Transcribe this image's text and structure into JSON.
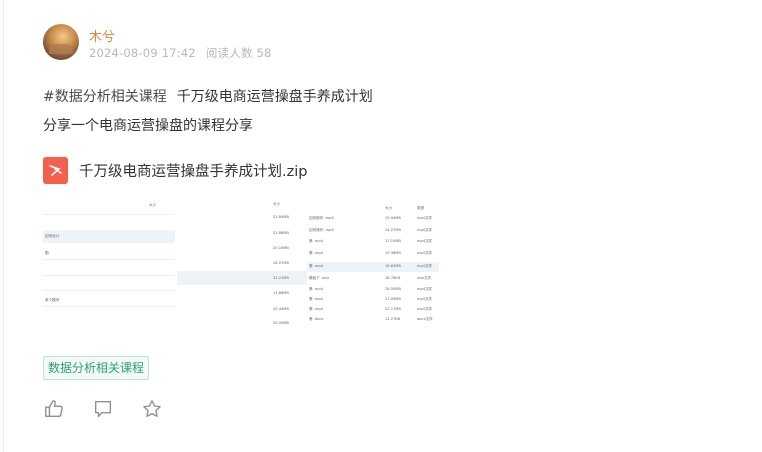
{
  "author": {
    "name": "木兮",
    "date": "2024-08-09 17:42",
    "reads": "阅读人数 58"
  },
  "post": {
    "topic": "#数据分析相关课程",
    "title": "千万级电商运营操盘手养成计划",
    "body": "分享一个电商运营操盘的课程分享"
  },
  "attachment": {
    "file_name": "千万级电商运营操盘手养成计划.zip",
    "icon": "pdf-style-file-icon"
  },
  "tag": {
    "label": "数据分析相关课程"
  },
  "actions": [
    {
      "name": "like-icon"
    },
    {
      "name": "comment-icon"
    },
    {
      "name": "favorite-star-icon"
    }
  ],
  "thumbs": {
    "t1": {
      "header": "大小",
      "rows": [
        "如何设计",
        "图",
        "某个模块"
      ]
    },
    "t2": {
      "header": "大小",
      "sizes": [
        "23.84MB",
        "23.88MB",
        "20.16MB",
        "26.07MB",
        "31.21MB",
        "11.68MB",
        "20.44MB",
        "20.50MB"
      ]
    },
    "t3": {
      "header1": "大小",
      "header2": "类型",
      "rows": [
        {
          "n": "如何制作 .mp4",
          "s": "19.94MB",
          "t": "mp4文件"
        },
        {
          "n": "如何操作 .mp4",
          "s": "24.07MB",
          "t": "mp4文件"
        },
        {
          "n": "第 .mp4",
          "s": "17.10MB",
          "t": "mp4文件"
        },
        {
          "n": "第 .mp4",
          "s": "19.38MB",
          "t": "mp4文件"
        },
        {
          "n": "第 .mp4",
          "s": "18.62MB",
          "t": "mp4文件"
        },
        {
          "n": "模板下 .xlsx",
          "s": "18.78KB",
          "t": "xlsx文件"
        },
        {
          "n": "第 .mp4",
          "s": "28.50MB",
          "t": "mp4文件"
        },
        {
          "n": "第 .mp4",
          "s": "21.05MB",
          "t": "mp4文件"
        },
        {
          "n": "第 .mp4",
          "s": "22.17MB",
          "t": "mp4文件"
        },
        {
          "n": "第 .docx",
          "s": "12.27KB",
          "t": "docx文件"
        }
      ]
    }
  }
}
